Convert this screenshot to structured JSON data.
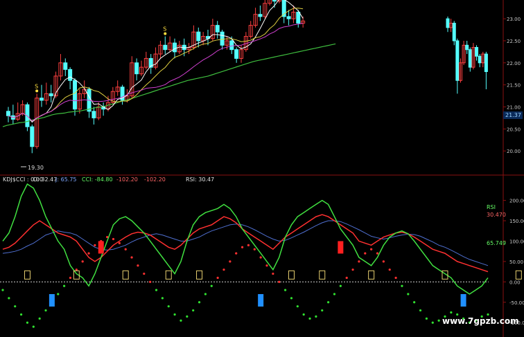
{
  "chart_data": [
    {
      "type": "candlestick",
      "price_axis": {
        "ylim": [
          19.5,
          23.3
        ],
        "ticks": [
          "23.00",
          "22.50",
          "22.00",
          "21.50",
          "21.00",
          "20.50",
          "20.00"
        ]
      },
      "last_price": "21.37",
      "low_marker": "19.30",
      "signal_label": "S",
      "signals_at": [
        6,
        33,
        57
      ],
      "candles": [
        [
          20.9,
          20.8,
          21.0,
          20.65
        ],
        [
          20.8,
          20.72,
          21.05,
          20.6
        ],
        [
          20.72,
          20.85,
          21.1,
          20.68
        ],
        [
          20.85,
          21.05,
          21.15,
          20.8
        ],
        [
          21.05,
          20.55,
          21.1,
          20.45
        ],
        [
          20.55,
          20.1,
          20.6,
          19.95
        ],
        [
          20.1,
          21.2,
          21.3,
          20.05
        ],
        [
          21.2,
          21.15,
          21.5,
          21.0
        ],
        [
          21.15,
          21.3,
          21.55,
          21.05
        ],
        [
          21.3,
          21.25,
          21.5,
          21.1
        ],
        [
          21.25,
          21.7,
          21.8,
          21.2
        ],
        [
          21.7,
          22.0,
          22.2,
          21.6
        ],
        [
          22.0,
          21.85,
          22.1,
          21.7
        ],
        [
          21.85,
          21.6,
          21.9,
          21.4
        ],
        [
          21.6,
          20.95,
          21.65,
          20.8
        ],
        [
          20.95,
          21.3,
          21.4,
          20.85
        ],
        [
          21.3,
          21.4,
          21.6,
          21.2
        ],
        [
          21.4,
          20.9,
          21.45,
          20.75
        ],
        [
          20.9,
          20.75,
          21.0,
          20.6
        ],
        [
          20.75,
          21.0,
          21.1,
          20.7
        ],
        [
          21.0,
          20.95,
          21.1,
          20.8
        ],
        [
          20.95,
          21.1,
          21.25,
          20.9
        ],
        [
          21.1,
          21.35,
          21.45,
          21.05
        ],
        [
          21.35,
          21.45,
          21.6,
          21.25
        ],
        [
          21.45,
          21.15,
          21.5,
          21.05
        ],
        [
          21.15,
          21.25,
          21.4,
          21.1
        ],
        [
          21.25,
          22.0,
          22.15,
          21.2
        ],
        [
          22.0,
          21.75,
          22.1,
          21.6
        ],
        [
          21.75,
          21.9,
          22.05,
          21.7
        ],
        [
          21.9,
          22.1,
          22.25,
          21.85
        ],
        [
          22.1,
          21.9,
          22.2,
          21.75
        ],
        [
          21.9,
          22.2,
          22.35,
          21.85
        ],
        [
          22.2,
          22.4,
          22.5,
          22.1
        ],
        [
          22.4,
          22.3,
          22.6,
          22.2
        ],
        [
          22.3,
          22.45,
          22.6,
          22.25
        ],
        [
          22.45,
          22.25,
          22.55,
          22.1
        ],
        [
          22.25,
          22.4,
          22.5,
          22.2
        ],
        [
          22.4,
          22.3,
          22.55,
          22.15
        ],
        [
          22.3,
          22.35,
          22.45,
          22.2
        ],
        [
          22.35,
          22.7,
          22.85,
          22.3
        ],
        [
          22.7,
          22.5,
          22.8,
          22.35
        ],
        [
          22.5,
          22.6,
          22.7,
          22.4
        ],
        [
          22.6,
          22.55,
          22.75,
          22.4
        ],
        [
          22.55,
          22.85,
          23.0,
          22.5
        ],
        [
          22.85,
          22.7,
          22.95,
          22.55
        ],
        [
          22.7,
          22.4,
          22.75,
          22.3
        ],
        [
          22.4,
          22.5,
          22.6,
          22.3
        ],
        [
          22.5,
          22.3,
          22.6,
          22.2
        ],
        [
          22.3,
          22.1,
          22.35,
          22.0
        ],
        [
          22.1,
          22.3,
          22.4,
          22.0
        ],
        [
          22.3,
          22.6,
          22.7,
          22.25
        ],
        [
          22.6,
          22.85,
          22.95,
          22.55
        ],
        [
          22.85,
          23.1,
          23.25,
          22.8
        ],
        [
          23.1,
          23.05,
          23.3,
          22.95
        ],
        [
          23.05,
          23.35,
          23.5,
          23.0
        ],
        [
          23.35,
          23.6,
          23.75,
          23.3
        ],
        [
          23.6,
          23.4,
          23.7,
          23.25
        ],
        [
          23.4,
          23.8,
          24.0,
          23.35
        ],
        [
          23.8,
          23.05,
          23.85,
          22.9
        ],
        [
          23.05,
          23.0,
          23.2,
          22.85
        ],
        [
          23.0,
          23.15,
          23.3,
          22.9
        ],
        [
          23.15,
          22.9,
          23.2,
          22.8
        ],
        [
          22.9,
          22.95,
          23.05,
          22.8
        ]
      ],
      "right_candles": [
        [
          23.0,
          22.8,
          23.05,
          22.7
        ],
        [
          22.8,
          22.9,
          23.0,
          22.7
        ],
        [
          22.9,
          22.5,
          22.95,
          22.4
        ],
        [
          22.5,
          21.6,
          22.55,
          21.3
        ],
        [
          21.6,
          22.0,
          22.1,
          21.55
        ],
        [
          22.0,
          22.4,
          22.5,
          21.95
        ],
        [
          22.4,
          22.3,
          22.5,
          22.2
        ],
        [
          22.3,
          21.9,
          22.35,
          21.8
        ],
        [
          21.9,
          22.35,
          22.45,
          21.85
        ],
        [
          22.35,
          22.15,
          22.4,
          22.05
        ],
        [
          22.15,
          22.0,
          22.2,
          21.9
        ],
        [
          22.0,
          22.2,
          22.25,
          21.9
        ],
        [
          22.2,
          21.8,
          22.25,
          21.4
        ]
      ],
      "ma_green": [
        20.55,
        20.58,
        20.6,
        20.62,
        20.64,
        20.65,
        20.67,
        20.7,
        20.72,
        20.74,
        20.76,
        20.79,
        20.82,
        20.84,
        20.85,
        20.86,
        20.88,
        20.89,
        20.9,
        20.91,
        20.93,
        20.95,
        20.97,
        20.99,
        21.0,
        21.02,
        21.05,
        21.07,
        21.1,
        21.13,
        21.15,
        21.18,
        21.21,
        21.24,
        21.27,
        21.3,
        21.33,
        21.36,
        21.39,
        21.42,
        21.45,
        21.48,
        21.51,
        21.54,
        21.57,
        21.6,
        21.62,
        21.64,
        21.66,
        21.68,
        21.7,
        21.73,
        21.76,
        21.79,
        21.82,
        21.85,
        21.88,
        21.91,
        21.94,
        21.97,
        22.0,
        22.03,
        22.05,
        22.07,
        22.09,
        22.11,
        22.13,
        22.15,
        22.17,
        22.19,
        22.21,
        22.23,
        22.25,
        22.27,
        22.29,
        22.31,
        22.33,
        22.35,
        22.37,
        22.39,
        22.41,
        22.43
      ]
    },
    {
      "type": "line",
      "header_labels": [
        "KDJ$CCI : 0.00",
        "D: 32.47",
        "J: 65.75",
        "CCI: -84.80",
        "-102.20",
        "-102.20",
        "RSI: 30.47"
      ],
      "ylim": [
        -120,
        240
      ],
      "ticks": [
        "200.00",
        "150.00",
        "100.00",
        "50.00",
        "0.00",
        "-50.00",
        "-100.00"
      ],
      "rsi_name": "RSI",
      "rsi_value": "30.470",
      "j_value": "65.749",
      "buy_markers": [
        8,
        42,
        75
      ],
      "sell_markers": [
        16,
        55,
        92
      ],
      "label_markers": [
        4,
        12,
        20,
        27,
        32,
        47,
        52,
        60,
        72,
        84,
        90,
        98,
        102
      ],
      "k": [
        80,
        85,
        95,
        110,
        125,
        140,
        150,
        140,
        130,
        120,
        115,
        110,
        100,
        80,
        60,
        50,
        60,
        75,
        90,
        100,
        110,
        118,
        122,
        120,
        115,
        105,
        95,
        85,
        80,
        90,
        105,
        120,
        130,
        135,
        140,
        150,
        160,
        155,
        145,
        130,
        120,
        110,
        100,
        90,
        80,
        95,
        110,
        120,
        130,
        140,
        150,
        160,
        165,
        160,
        150,
        140,
        130,
        120,
        100,
        95,
        90,
        100,
        110,
        115,
        120,
        122,
        118,
        110,
        100,
        90,
        80,
        75,
        70,
        60,
        50,
        45,
        40,
        35,
        30,
        25
      ],
      "d": [
        70,
        72,
        75,
        80,
        88,
        95,
        105,
        115,
        120,
        125,
        122,
        120,
        115,
        105,
        95,
        85,
        80,
        78,
        80,
        85,
        90,
        98,
        105,
        110,
        115,
        118,
        115,
        110,
        105,
        100,
        100,
        105,
        110,
        118,
        125,
        130,
        135,
        140,
        142,
        140,
        135,
        128,
        120,
        112,
        105,
        100,
        102,
        108,
        115,
        122,
        130,
        138,
        145,
        150,
        150,
        148,
        142,
        135,
        128,
        120,
        112,
        108,
        105,
        108,
        112,
        115,
        117,
        116,
        112,
        105,
        98,
        90,
        85,
        78,
        70,
        62,
        55,
        50,
        45,
        40
      ],
      "j": [
        100,
        120,
        160,
        210,
        240,
        230,
        200,
        160,
        130,
        100,
        80,
        40,
        20,
        10,
        -10,
        20,
        60,
        100,
        140,
        155,
        160,
        150,
        135,
        120,
        100,
        80,
        60,
        40,
        20,
        50,
        100,
        140,
        160,
        170,
        175,
        180,
        190,
        180,
        160,
        130,
        110,
        90,
        70,
        50,
        30,
        60,
        110,
        140,
        160,
        170,
        180,
        190,
        200,
        190,
        160,
        130,
        110,
        90,
        60,
        50,
        40,
        60,
        90,
        110,
        120,
        125,
        118,
        100,
        80,
        60,
        40,
        30,
        20,
        10,
        -10,
        -20,
        -30,
        -20,
        -10,
        10
      ],
      "dots": [
        -20,
        -40,
        -60,
        -80,
        -100,
        -110,
        -90,
        -70,
        -50,
        -30,
        -10,
        10,
        30,
        50,
        70,
        90,
        100,
        110,
        105,
        95,
        80,
        60,
        40,
        20,
        0,
        -20,
        -40,
        -60,
        -80,
        -95,
        -85,
        -70,
        -50,
        -30,
        -10,
        10,
        30,
        50,
        70,
        85,
        90,
        80,
        60,
        40,
        20,
        0,
        -20,
        -40,
        -60,
        -80,
        -90,
        -85,
        -70,
        -50,
        -30,
        -10,
        10,
        30,
        50,
        70,
        80,
        70,
        50,
        30,
        10,
        -10,
        -30,
        -50,
        -70,
        -90,
        -100,
        -95,
        -85,
        -75,
        -80,
        -90,
        -100,
        -95,
        -85,
        -80
      ]
    }
  ],
  "watermark": "www.7gpzb.com"
}
